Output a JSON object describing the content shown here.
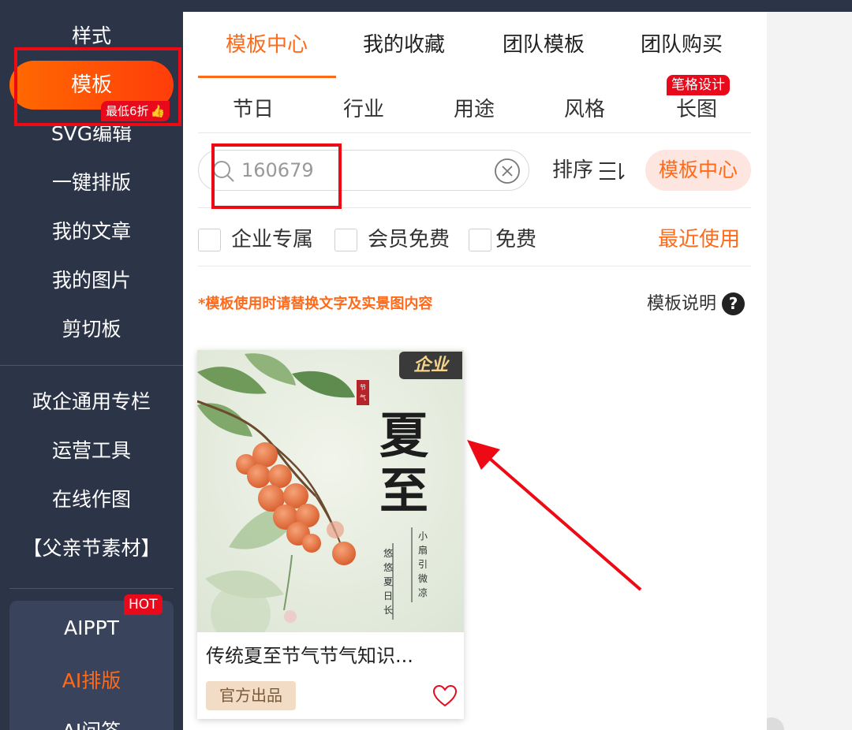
{
  "sidebar": {
    "items": [
      {
        "label": "样式"
      },
      {
        "label": "模板"
      },
      {
        "label": "SVG编辑"
      },
      {
        "label": "一键排版"
      },
      {
        "label": "我的文章"
      },
      {
        "label": "我的图片"
      },
      {
        "label": "剪切板"
      },
      {
        "label": "政企通用专栏"
      },
      {
        "label": "运营工具"
      },
      {
        "label": "在线作图"
      },
      {
        "label": "【父亲节素材】"
      }
    ],
    "discount_badge": "最低6折",
    "ai": {
      "hot_badge": "HOT",
      "items": [
        {
          "label": "AIPPT"
        },
        {
          "label": "AI排版"
        },
        {
          "label": "AI问答"
        }
      ]
    }
  },
  "tabs": [
    {
      "label": "模板中心",
      "active": true
    },
    {
      "label": "我的收藏"
    },
    {
      "label": "团队模板"
    },
    {
      "label": "团队购买"
    }
  ],
  "categories": [
    {
      "label": "节日"
    },
    {
      "label": "行业"
    },
    {
      "label": "用途"
    },
    {
      "label": "风格"
    },
    {
      "label": "长图"
    }
  ],
  "category_badge": "笔格设计",
  "search": {
    "value": "160679"
  },
  "sort_label": "排序",
  "template_center_button": "模板中心",
  "filters": [
    {
      "label": "企业专属",
      "checked": false
    },
    {
      "label": "会员免费",
      "checked": false
    },
    {
      "label": "免费",
      "checked": false
    }
  ],
  "recent_label": "最近使用",
  "notice": "*模板使用时请替换文字及实景图内容",
  "explain_label": "模板说明",
  "template_card": {
    "badge": "企业",
    "title": "传统夏至节气节气知识...",
    "official_tag": "官方出品",
    "poster_text": {
      "seal": "节气",
      "big1": "夏",
      "big2": "至",
      "line1": "小扇引微凉",
      "line2": "悠悠夏日长"
    }
  },
  "colors": {
    "accent": "#ff6a1a",
    "sidebar_bg": "#2c3447",
    "badge_red": "#e8091b",
    "annotation_red": "#ee0a14"
  }
}
